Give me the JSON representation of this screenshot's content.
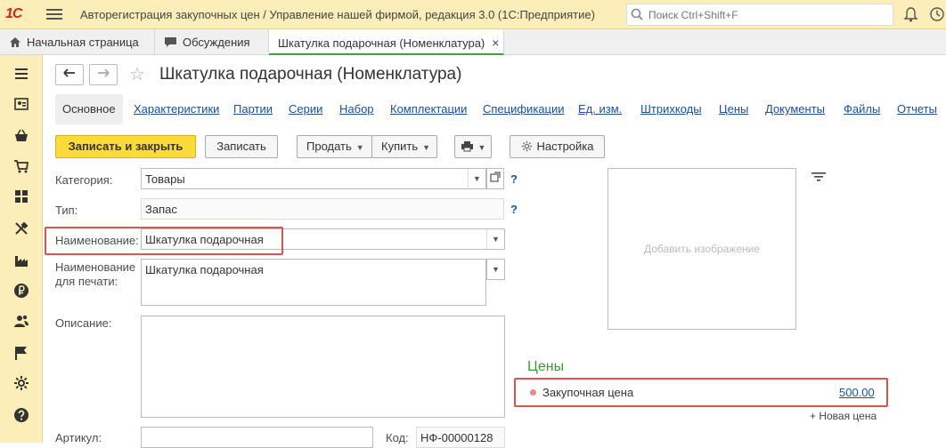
{
  "app": {
    "logo": "1С",
    "window_title": "Авторегистрация закупочных цен / Управление нашей фирмой, редакция 3.0  (1С:Предприятие)",
    "search_placeholder": "Поиск Ctrl+Shift+F"
  },
  "tabs": [
    {
      "label": "Начальная страница",
      "icon": "home-icon"
    },
    {
      "label": "Обсуждения",
      "icon": "chat-icon"
    },
    {
      "label": "Шкатулка подарочная (Номенклатура)",
      "active": true
    }
  ],
  "tab_close_symbol": "×",
  "form": {
    "title": "Шкатулка подарочная (Номенклатура)",
    "section_tabs": [
      "Основное",
      "Характеристики",
      "Партии",
      "Серии",
      "Набор",
      "Комплектации",
      "Спецификации",
      "Ед. изм.",
      "Штрихкоды",
      "Цены",
      "Документы",
      "Файлы",
      "Отчеты"
    ],
    "toolbar": {
      "save_close": "Записать и закрыть",
      "save": "Записать",
      "sell": "Продать",
      "buy": "Купить",
      "settings": "Настройка"
    },
    "fields": {
      "category_label": "Категория:",
      "category_value": "Товары",
      "type_label": "Тип:",
      "type_value": "Запас",
      "name_label": "Наименование:",
      "name_value": "Шкатулка подарочная",
      "print_name_label_1": "Наименование",
      "print_name_label_2": "для печати:",
      "print_name_value": "Шкатулка подарочная",
      "description_label": "Описание:",
      "description_value": "",
      "article_label": "Артикул:",
      "article_value": "",
      "code_label": "Код:",
      "code_value": "НФ-00000128",
      "help_symbol": "?"
    },
    "image_placeholder": "Добавить изображение",
    "prices": {
      "title": "Цены",
      "items": [
        {
          "name": "Закупочная цена",
          "value": "500.00"
        }
      ],
      "new_price": "+ Новая цена"
    }
  },
  "colors": {
    "accent_yellow": "#fbdb3a",
    "highlight_red": "#d9534f",
    "link_blue": "#1a4f9c",
    "prices_green": "#3c9a3c"
  }
}
